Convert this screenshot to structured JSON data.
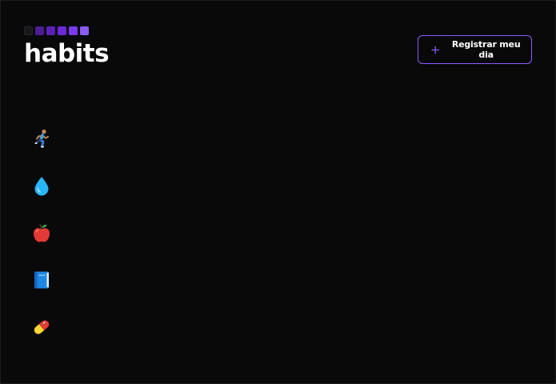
{
  "app": {
    "logo_text": "habits"
  },
  "header": {
    "new_day_button_label": "Registrar meu dia",
    "new_day_button_icon": "plus-icon"
  },
  "colors": {
    "background": "#09090a",
    "accent": "#8b5cf6",
    "text": "#ffffff"
  },
  "habits": [
    {
      "icon": "running-icon"
    },
    {
      "icon": "water-drop-icon"
    },
    {
      "icon": "apple-icon"
    },
    {
      "icon": "book-icon"
    },
    {
      "icon": "pill-icon"
    }
  ]
}
